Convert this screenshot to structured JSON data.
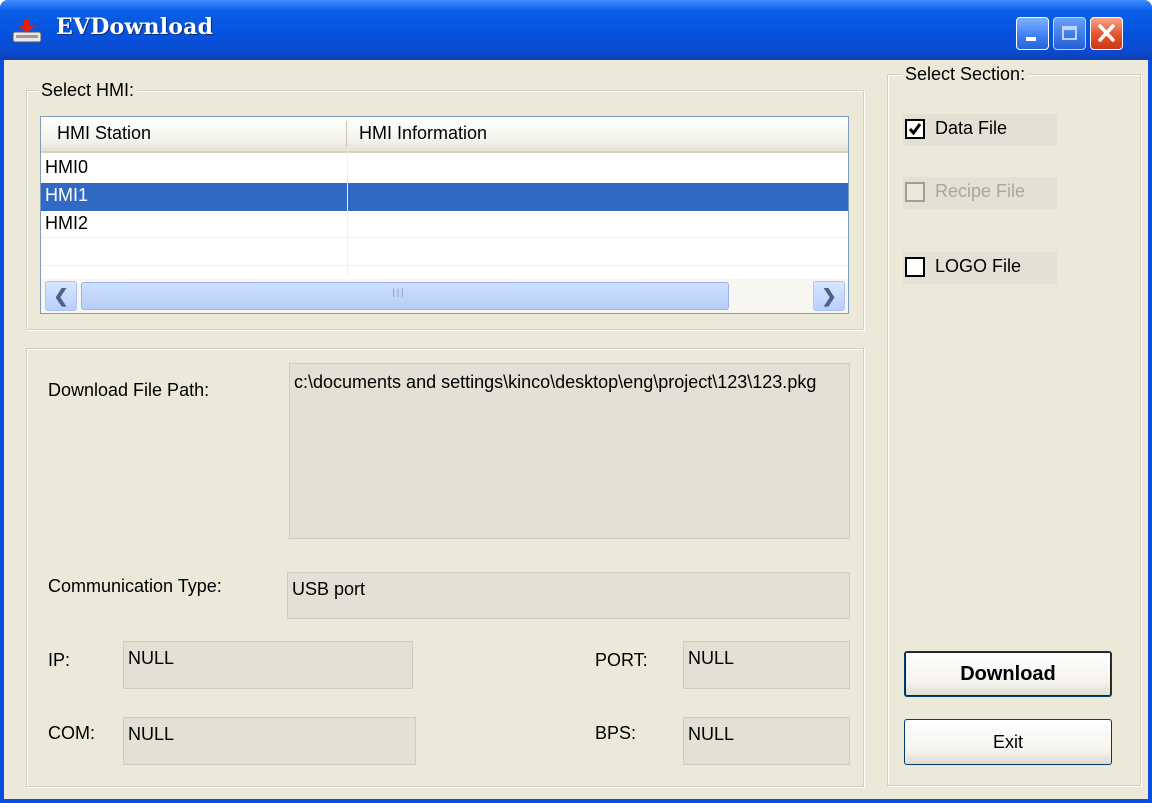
{
  "window": {
    "title": "EVDownload"
  },
  "hmi_group": {
    "legend": "Select HMI:",
    "columns": [
      "HMI Station",
      "HMI Information"
    ],
    "rows": [
      {
        "station": "HMI0",
        "info": ""
      },
      {
        "station": "HMI1",
        "info": "",
        "selected": true
      },
      {
        "station": "HMI2",
        "info": ""
      }
    ],
    "scroll_grip": "III"
  },
  "details": {
    "download_path_label": "Download File Path:",
    "download_path_value": "c:\\documents and settings\\kinco\\desktop\\eng\\project\\123\\123.pkg",
    "comm_type_label": "Communication Type:",
    "comm_type_value": "USB port",
    "ip_label": "IP:",
    "ip_value": "NULL",
    "port_label": "PORT:",
    "port_value": "NULL",
    "com_label": "COM:",
    "com_value": "NULL",
    "bps_label": "BPS:",
    "bps_value": "NULL"
  },
  "section_group": {
    "legend": "Select Section:",
    "options": [
      {
        "label": "Data File",
        "checked": true,
        "enabled": true
      },
      {
        "label": "Recipe File",
        "checked": false,
        "enabled": false
      },
      {
        "label": "LOGO File",
        "checked": false,
        "enabled": true
      }
    ]
  },
  "buttons": {
    "download": "Download",
    "exit": "Exit"
  },
  "colors": {
    "title_bar": "#0552de",
    "selection": "#316ac5",
    "dialog_bg": "#ece9d8"
  }
}
